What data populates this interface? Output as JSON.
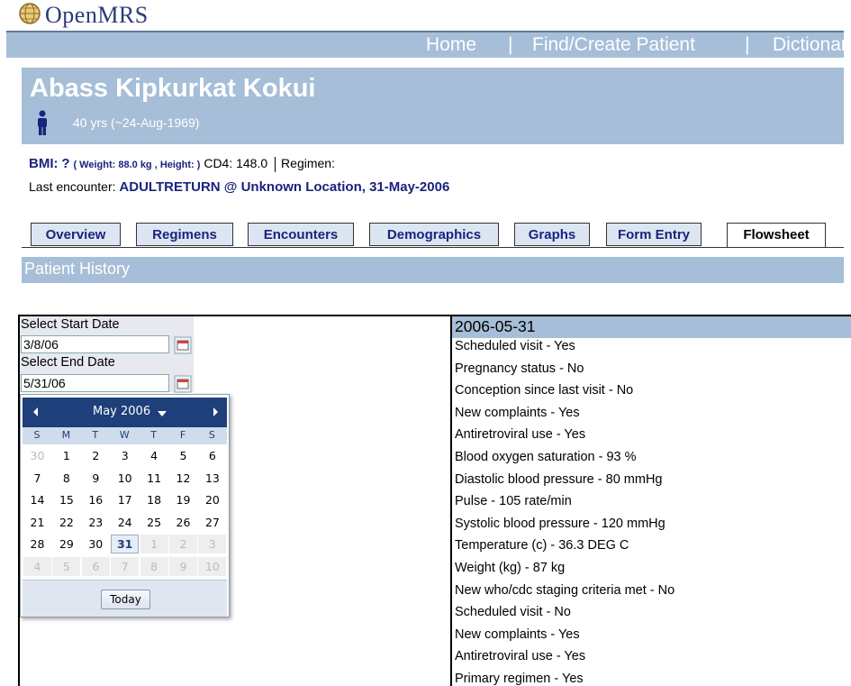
{
  "app": {
    "logo_text": "OpenMRS"
  },
  "nav": {
    "items": [
      "Home",
      "|",
      "Find/Create Patient",
      "|",
      "Dictionary"
    ]
  },
  "patient": {
    "name": "Abass Kipkurkat Kokui",
    "age_text": "40 yrs (~24-Aug-1969)",
    "bmi_label": "BMI:",
    "bmi_value": "?",
    "bmi_detail": "( Weight: 88.0 kg , Height: )",
    "cd4": "CD4: 148.0",
    "regimen": "Regimen:",
    "last_encounter_label": "Last encounter:",
    "last_encounter_value": "ADULTRETURN @ Unknown Location, 31-May-2006"
  },
  "tabs": [
    "Overview",
    "Regimens",
    "Encounters",
    "Demographics",
    "Graphs",
    "Form Entry",
    "Flowsheet"
  ],
  "active_tab": "Flowsheet",
  "section": {
    "title": "Patient History"
  },
  "date_filter": {
    "start_label": "Select Start Date",
    "start_value": "3/8/06",
    "end_label": "Select End Date",
    "end_value": "5/31/06"
  },
  "calendar": {
    "month": "May 2006",
    "weekdays": [
      "S",
      "M",
      "T",
      "W",
      "T",
      "F",
      "S"
    ],
    "days": [
      [
        "30",
        "1",
        "2",
        "3",
        "4",
        "5",
        "6"
      ],
      [
        "7",
        "8",
        "9",
        "10",
        "11",
        "12",
        "13"
      ],
      [
        "14",
        "15",
        "16",
        "17",
        "18",
        "19",
        "20"
      ],
      [
        "21",
        "22",
        "23",
        "24",
        "25",
        "26",
        "27"
      ],
      [
        "28",
        "29",
        "30",
        "31",
        "1",
        "2",
        "3"
      ],
      [
        "4",
        "5",
        "6",
        "7",
        "8",
        "9",
        "10"
      ]
    ],
    "selected_day": "31",
    "today_label": "Today"
  },
  "observations": {
    "date": "2006-05-31",
    "items": [
      "Scheduled visit - Yes",
      "Pregnancy status - No",
      "Conception since last visit - No",
      "New complaints - Yes",
      "Antiretroviral use - Yes",
      "Blood oxygen saturation - 93 %",
      "Diastolic blood pressure - 80 mmHg",
      "Pulse - 105 rate/min",
      "Systolic blood pressure - 120 mmHg",
      "Temperature (c) - 36.3 DEG C",
      "Weight (kg) - 87 kg",
      "New who/cdc staging criteria met - No",
      "Scheduled visit - No",
      "New complaints - Yes",
      "Antiretroviral use - Yes",
      "Primary regimen - Yes"
    ]
  },
  "colors": {
    "bar": "#a6bed7",
    "navy": "#1a237e",
    "calendar_header": "#1e3f7a"
  }
}
